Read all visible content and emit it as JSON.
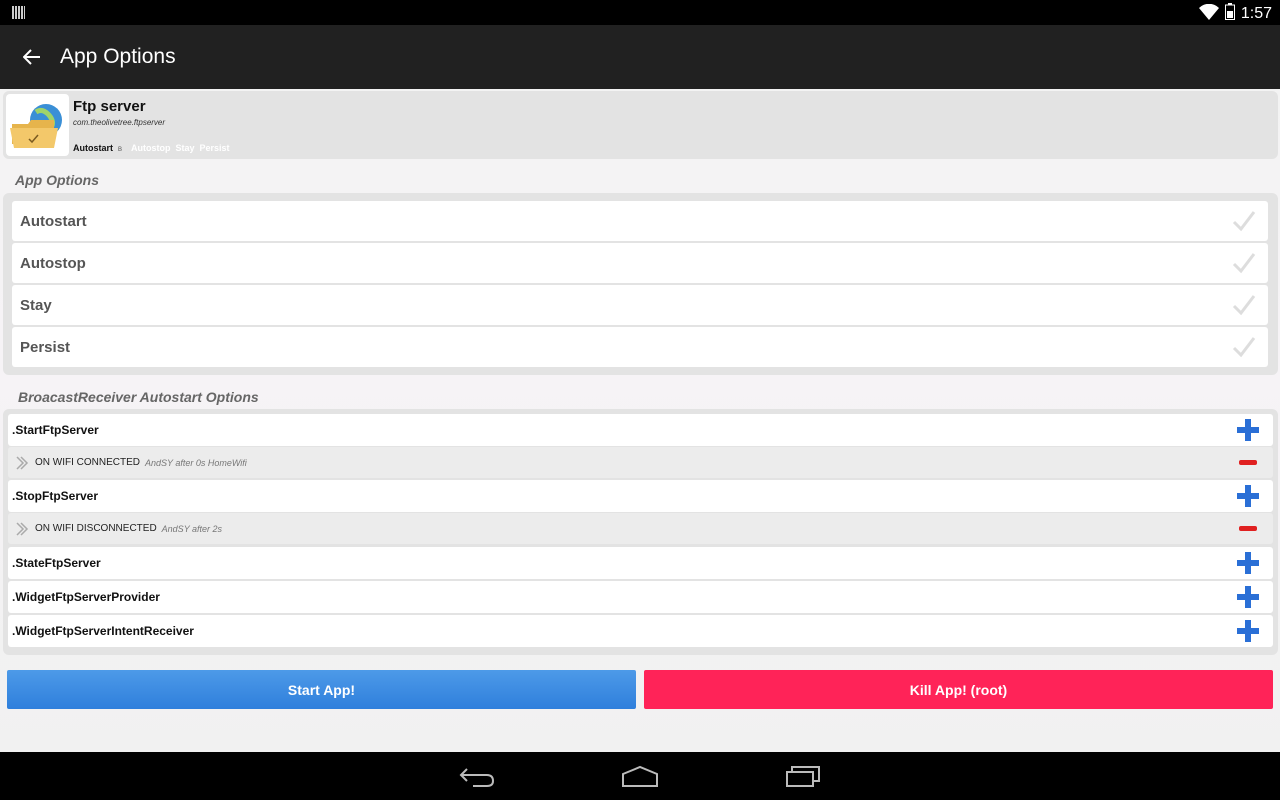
{
  "status": {
    "time": "1:57"
  },
  "action_bar": {
    "title": "App Options"
  },
  "app": {
    "name": "Ftp server",
    "package": "com.theolivetree.ftpserver",
    "flags": [
      {
        "label": "Autostart",
        "sup": "B",
        "active": true
      },
      {
        "label": "Autostop",
        "active": false
      },
      {
        "label": "Stay",
        "active": false
      },
      {
        "label": "Persist",
        "active": false
      }
    ]
  },
  "app_options": {
    "header": "App Options",
    "items": [
      {
        "label": "Autostart"
      },
      {
        "label": "Autostop"
      },
      {
        "label": "Stay"
      },
      {
        "label": "Persist"
      }
    ]
  },
  "receivers": {
    "header": "BroacastReceiver Autostart Options",
    "items": [
      {
        "name": ".StartFtpServer",
        "trigger": {
          "event": "ON WIFI CONNECTED",
          "detail": "AndSY after 0s HomeWifi"
        }
      },
      {
        "name": ".StopFtpServer",
        "trigger": {
          "event": "ON WIFI DISCONNECTED",
          "detail": "AndSY after 2s"
        }
      },
      {
        "name": ".StateFtpServer"
      },
      {
        "name": ".WidgetFtpServerProvider"
      },
      {
        "name": ".WidgetFtpServerIntentReceiver"
      }
    ]
  },
  "buttons": {
    "start": "Start App!",
    "kill": "Kill App! (root)"
  },
  "colors": {
    "start_button": "#2f7fdc",
    "kill_button": "#ff2358",
    "plus_icon": "#2a6fd6",
    "minus_icon": "#e02020"
  }
}
